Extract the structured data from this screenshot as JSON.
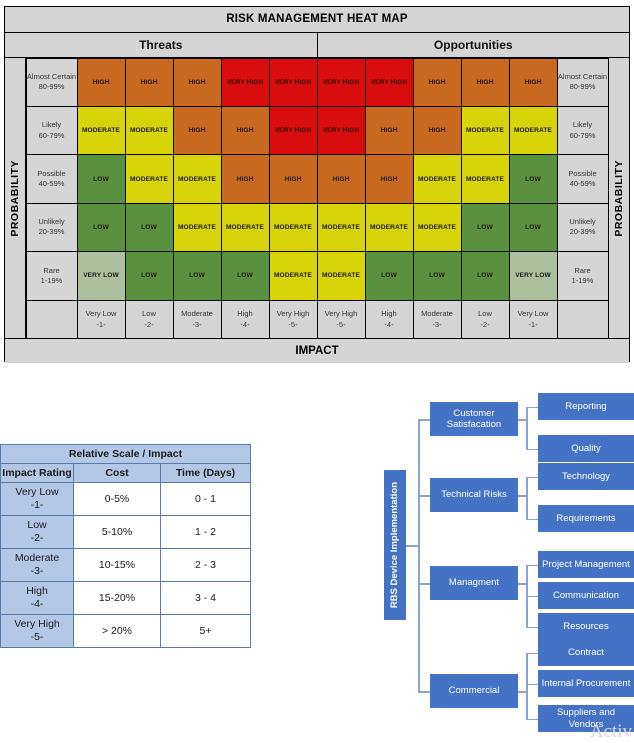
{
  "heatmap": {
    "title": "RISK MANAGEMENT HEAT MAP",
    "categories": {
      "left": "Threats",
      "right": "Opportunities"
    },
    "axis_labels": {
      "probability": "PROBABILITY",
      "impact": "IMPACT"
    },
    "probability_rows": [
      {
        "name": "Almost Certain",
        "range": "80-99%"
      },
      {
        "name": "Likely",
        "range": "60-79%"
      },
      {
        "name": "Possible",
        "range": "40-59%"
      },
      {
        "name": "Unlikely",
        "range": "20-39%"
      },
      {
        "name": "Rare",
        "range": "1-19%"
      }
    ],
    "impact_columns": [
      {
        "name": "Very Low",
        "score": "-1-"
      },
      {
        "name": "Low",
        "score": "-2-"
      },
      {
        "name": "Moderate",
        "score": "-3-"
      },
      {
        "name": "High",
        "score": "-4-"
      },
      {
        "name": "Very High",
        "score": "-5-"
      },
      {
        "name": "Very High",
        "score": "-5-"
      },
      {
        "name": "High",
        "score": "-4-"
      },
      {
        "name": "Moderate",
        "score": "-3-"
      },
      {
        "name": "Low",
        "score": "-2-"
      },
      {
        "name": "Very Low",
        "score": "-1-"
      }
    ],
    "level_colors": {
      "VERY HIGH": "#d90d0d",
      "HIGH": "#c8691f",
      "MODERATE": "#d9d40a",
      "LOW": "#5a913e",
      "VERY LOW": "#adbf9d"
    },
    "cells": [
      [
        "HIGH",
        "HIGH",
        "HIGH",
        "VERY HIGH",
        "VERY HIGH",
        "VERY HIGH",
        "VERY HIGH",
        "HIGH",
        "HIGH",
        "HIGH"
      ],
      [
        "MODERATE",
        "MODERATE",
        "HIGH",
        "HIGH",
        "VERY HIGH",
        "VERY HIGH",
        "HIGH",
        "HIGH",
        "MODERATE",
        "MODERATE"
      ],
      [
        "LOW",
        "MODERATE",
        "MODERATE",
        "HIGH",
        "HIGH",
        "HIGH",
        "HIGH",
        "MODERATE",
        "MODERATE",
        "LOW"
      ],
      [
        "LOW",
        "LOW",
        "MODERATE",
        "MODERATE",
        "MODERATE",
        "MODERATE",
        "MODERATE",
        "MODERATE",
        "LOW",
        "LOW"
      ],
      [
        "VERY LOW",
        "LOW",
        "LOW",
        "LOW",
        "MODERATE",
        "MODERATE",
        "LOW",
        "LOW",
        "LOW",
        "VERY LOW"
      ]
    ]
  },
  "scale_table": {
    "title": "Relative Scale / Impact",
    "headers": [
      "Impact Rating",
      "Cost",
      "Time (Days)"
    ],
    "rows": [
      {
        "rating": "Very Low",
        "score": "-1-",
        "cost": "0-5%",
        "time": "0 - 1"
      },
      {
        "rating": "Low",
        "score": "-2-",
        "cost": "5-10%",
        "time": "1 - 2"
      },
      {
        "rating": "Moderate",
        "score": "-3-",
        "cost": "10-15%",
        "time": "2 - 3"
      },
      {
        "rating": "High",
        "score": "-4-",
        "cost": "15-20%",
        "time": "3 - 4"
      },
      {
        "rating": "Very High",
        "score": "-5-",
        "cost": "> 20%",
        "time": "5+"
      }
    ]
  },
  "rbs": {
    "root": "RBS Device Implementation",
    "branches": [
      {
        "label": "Customer Satisfacation",
        "children": [
          "Reporting",
          "Quality"
        ]
      },
      {
        "label": "Technical Risks",
        "children": [
          "Technology",
          "Requirements"
        ]
      },
      {
        "label": "Managment",
        "children": [
          "Project Management",
          "Communication",
          "Resources"
        ]
      },
      {
        "label": "Commercial",
        "children": [
          "Contract",
          "Internal Procurement",
          "Suppliers and Vendors"
        ]
      }
    ],
    "node_color": "#4472c4"
  },
  "watermark": "Activ"
}
